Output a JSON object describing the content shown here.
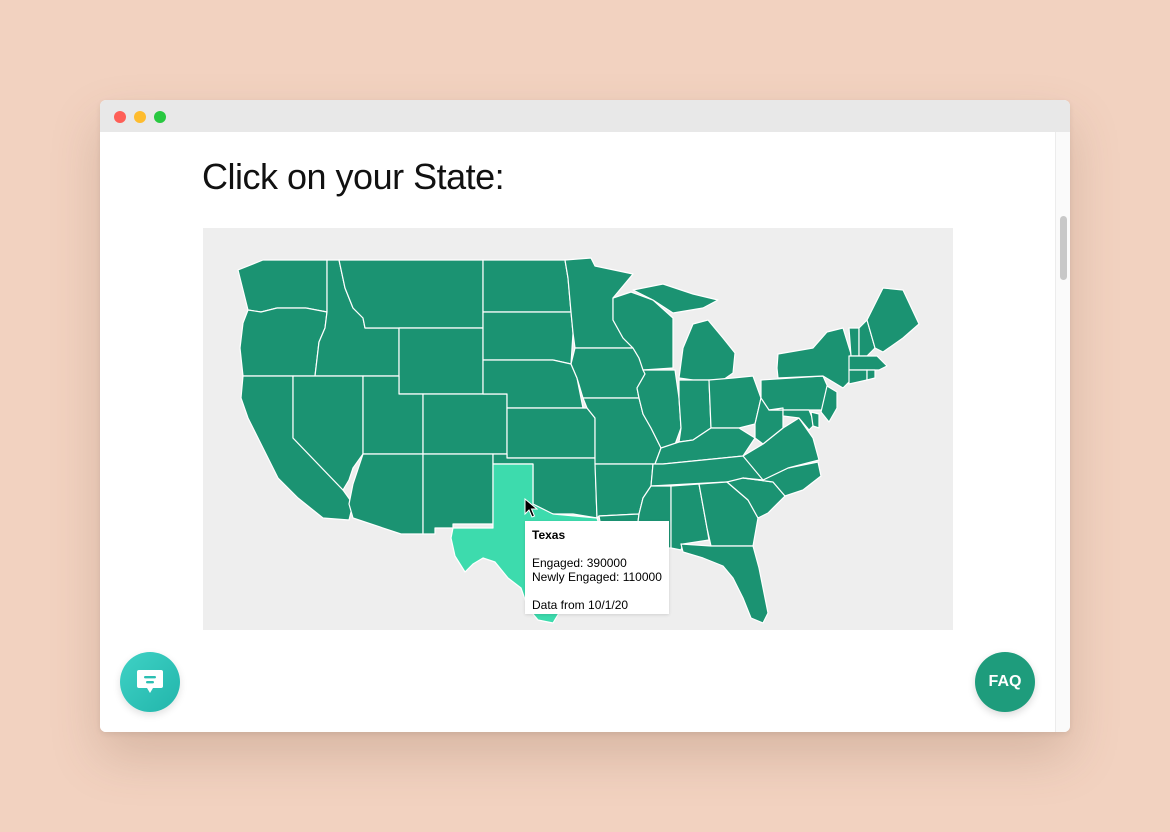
{
  "page": {
    "heading": "Click on your State:"
  },
  "map": {
    "fill_color": "#1b9372",
    "hover_color": "#3ddbad",
    "background": "#eeeeee",
    "hovered_state": "Texas"
  },
  "tooltip": {
    "state": "Texas",
    "engaged": "Engaged: 390000",
    "newly_engaged": "Newly Engaged: 110000",
    "data_date": "Data from 10/1/20"
  },
  "buttons": {
    "faq_label": "FAQ",
    "chat_icon": "chat-bubble-icon"
  },
  "colors": {
    "page_background": "#f2d2c0",
    "accent": "#1e9c7c",
    "chat_gradient_start": "#3fd2c5"
  }
}
